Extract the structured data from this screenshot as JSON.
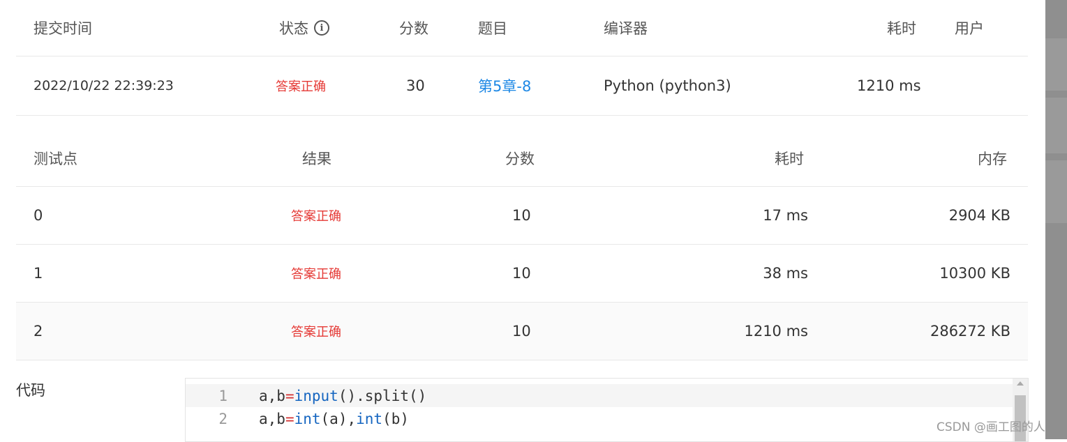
{
  "submission": {
    "headers": {
      "time": "提交时间",
      "status": "状态",
      "score": "分数",
      "problem": "题目",
      "compiler": "编译器",
      "elapsed": "耗时",
      "user": "用户"
    },
    "row": {
      "time": "2022/10/22 22:39:23",
      "status": "答案正确",
      "score": "30",
      "problem": "第5章-8",
      "compiler": "Python (python3)",
      "elapsed": "1210 ms",
      "user": ""
    }
  },
  "testcases": {
    "headers": {
      "point": "测试点",
      "result": "结果",
      "score": "分数",
      "elapsed": "耗时",
      "memory": "内存"
    },
    "rows": [
      {
        "point": "0",
        "result": "答案正确",
        "score": "10",
        "elapsed": "17 ms",
        "memory": "2904 KB"
      },
      {
        "point": "1",
        "result": "答案正确",
        "score": "10",
        "elapsed": "38 ms",
        "memory": "10300 KB"
      },
      {
        "point": "2",
        "result": "答案正确",
        "score": "10",
        "elapsed": "1210 ms",
        "memory": "286272 KB"
      }
    ]
  },
  "code_section": {
    "label": "代码",
    "lines": [
      {
        "num": "1",
        "tokens": [
          {
            "t": "a,b"
          },
          {
            "t": "=",
            "c": "op"
          },
          {
            "t": "input",
            "c": "kw"
          },
          {
            "t": "().split()"
          }
        ]
      },
      {
        "num": "2",
        "tokens": [
          {
            "t": "a,b"
          },
          {
            "t": "=",
            "c": "op"
          },
          {
            "t": "int",
            "c": "kw"
          },
          {
            "t": "(a),"
          },
          {
            "t": "int",
            "c": "kw"
          },
          {
            "t": "(b)"
          }
        ]
      }
    ]
  },
  "watermark": "CSDN @画工图的人",
  "colors": {
    "accepted": "#e53935",
    "link": "#1e88e5",
    "keyword": "#1565c0",
    "operator": "#d32f2f"
  }
}
